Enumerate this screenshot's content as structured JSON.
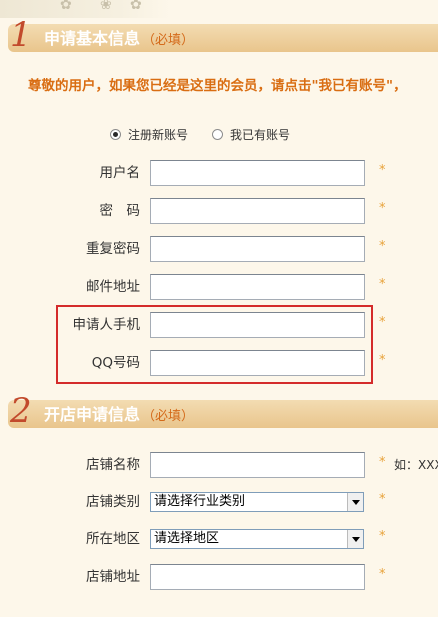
{
  "section1": {
    "number": "1",
    "title": "申请基本信息",
    "required_note": "（必填）"
  },
  "notice": "尊敬的用户，如果您已经是这里的会员，请点击\"我已有账号\"，",
  "account_choice": {
    "options": [
      "注册新账号",
      "我已有账号"
    ],
    "selected": "注册新账号"
  },
  "basic_fields": [
    {
      "label": "用户名",
      "value": "",
      "required_mark": "*"
    },
    {
      "label": "密　码",
      "value": "",
      "required_mark": "*"
    },
    {
      "label": "重复密码",
      "value": "",
      "required_mark": "*"
    },
    {
      "label": "邮件地址",
      "value": "",
      "required_mark": "*"
    },
    {
      "label": "申请人手机",
      "value": "",
      "required_mark": "*"
    },
    {
      "label": "QQ号码",
      "value": "",
      "required_mark": "*"
    }
  ],
  "section2": {
    "number": "2",
    "title": "开店申请信息",
    "required_note": "（必填）"
  },
  "shop_fields": {
    "name": {
      "label": "店铺名称",
      "value": "",
      "required_mark": "*",
      "hint": "如：XXX"
    },
    "category": {
      "label": "店铺类别",
      "selected": "请选择行业类别",
      "required_mark": "*"
    },
    "region": {
      "label": "所在地区",
      "selected": "请选择地区",
      "required_mark": "*"
    },
    "address": {
      "label": "店铺地址",
      "value": "",
      "required_mark": "*"
    }
  },
  "colors": {
    "accent": "#d96d12",
    "section_number": "#c24a2c",
    "highlight": "#d42b2b",
    "star": "#e8a23a"
  }
}
